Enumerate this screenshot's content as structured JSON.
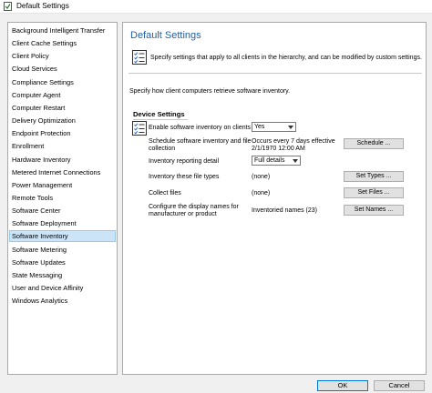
{
  "window": {
    "title": "Default Settings"
  },
  "sidebar": {
    "items": [
      {
        "label": "Background Intelligent Transfer"
      },
      {
        "label": "Client Cache Settings"
      },
      {
        "label": "Client Policy"
      },
      {
        "label": "Cloud Services"
      },
      {
        "label": "Compliance Settings"
      },
      {
        "label": "Computer Agent"
      },
      {
        "label": "Computer Restart"
      },
      {
        "label": "Delivery Optimization"
      },
      {
        "label": "Endpoint Protection"
      },
      {
        "label": "Enrollment"
      },
      {
        "label": "Hardware Inventory"
      },
      {
        "label": "Metered Internet Connections"
      },
      {
        "label": "Power Management"
      },
      {
        "label": "Remote Tools"
      },
      {
        "label": "Software Center"
      },
      {
        "label": "Software Deployment"
      },
      {
        "label": "Software Inventory"
      },
      {
        "label": "Software Metering"
      },
      {
        "label": "Software Updates"
      },
      {
        "label": "State Messaging"
      },
      {
        "label": "User and Device Affinity"
      },
      {
        "label": "Windows Analytics"
      }
    ],
    "selected": "Software Inventory"
  },
  "panel": {
    "title": "Default Settings",
    "description": "Specify settings that apply to all clients in the hierarchy, and can be modified by custom settings.",
    "inventory_text": "Specify how client computers retrieve software inventory.",
    "section_title": "Device Settings",
    "rows": {
      "enable": {
        "label": "Enable software inventory on clients",
        "value": "Yes"
      },
      "schedule": {
        "label_line1": "Schedule software inventory and file",
        "label_line2": "collection",
        "value_line1": "Occurs every 7 days effective",
        "value_line2": "2/1/1970 12:00 AM",
        "button": "Schedule ..."
      },
      "detail": {
        "label": "Inventory reporting detail",
        "value": "Full details"
      },
      "file_types": {
        "label": "Inventory these file types",
        "value": "(none)",
        "button": "Set Types ..."
      },
      "collect": {
        "label": "Collect files",
        "value": "(none)",
        "button": "Set Files ..."
      },
      "names": {
        "label_line1": "Configure the display names for",
        "label_line2": "manufacturer or product",
        "value": "Inventoried names (23)",
        "button": "Set Names ..."
      }
    }
  },
  "footer": {
    "ok": "OK",
    "cancel": "Cancel"
  },
  "colors": {
    "accent": "#1e5fa6",
    "selection": "#cce4f7",
    "selection_border": "#99c9ef"
  },
  "icons": {
    "app": "settings-check-icon",
    "description": "checklist-icon",
    "section": "checklist-icon"
  }
}
